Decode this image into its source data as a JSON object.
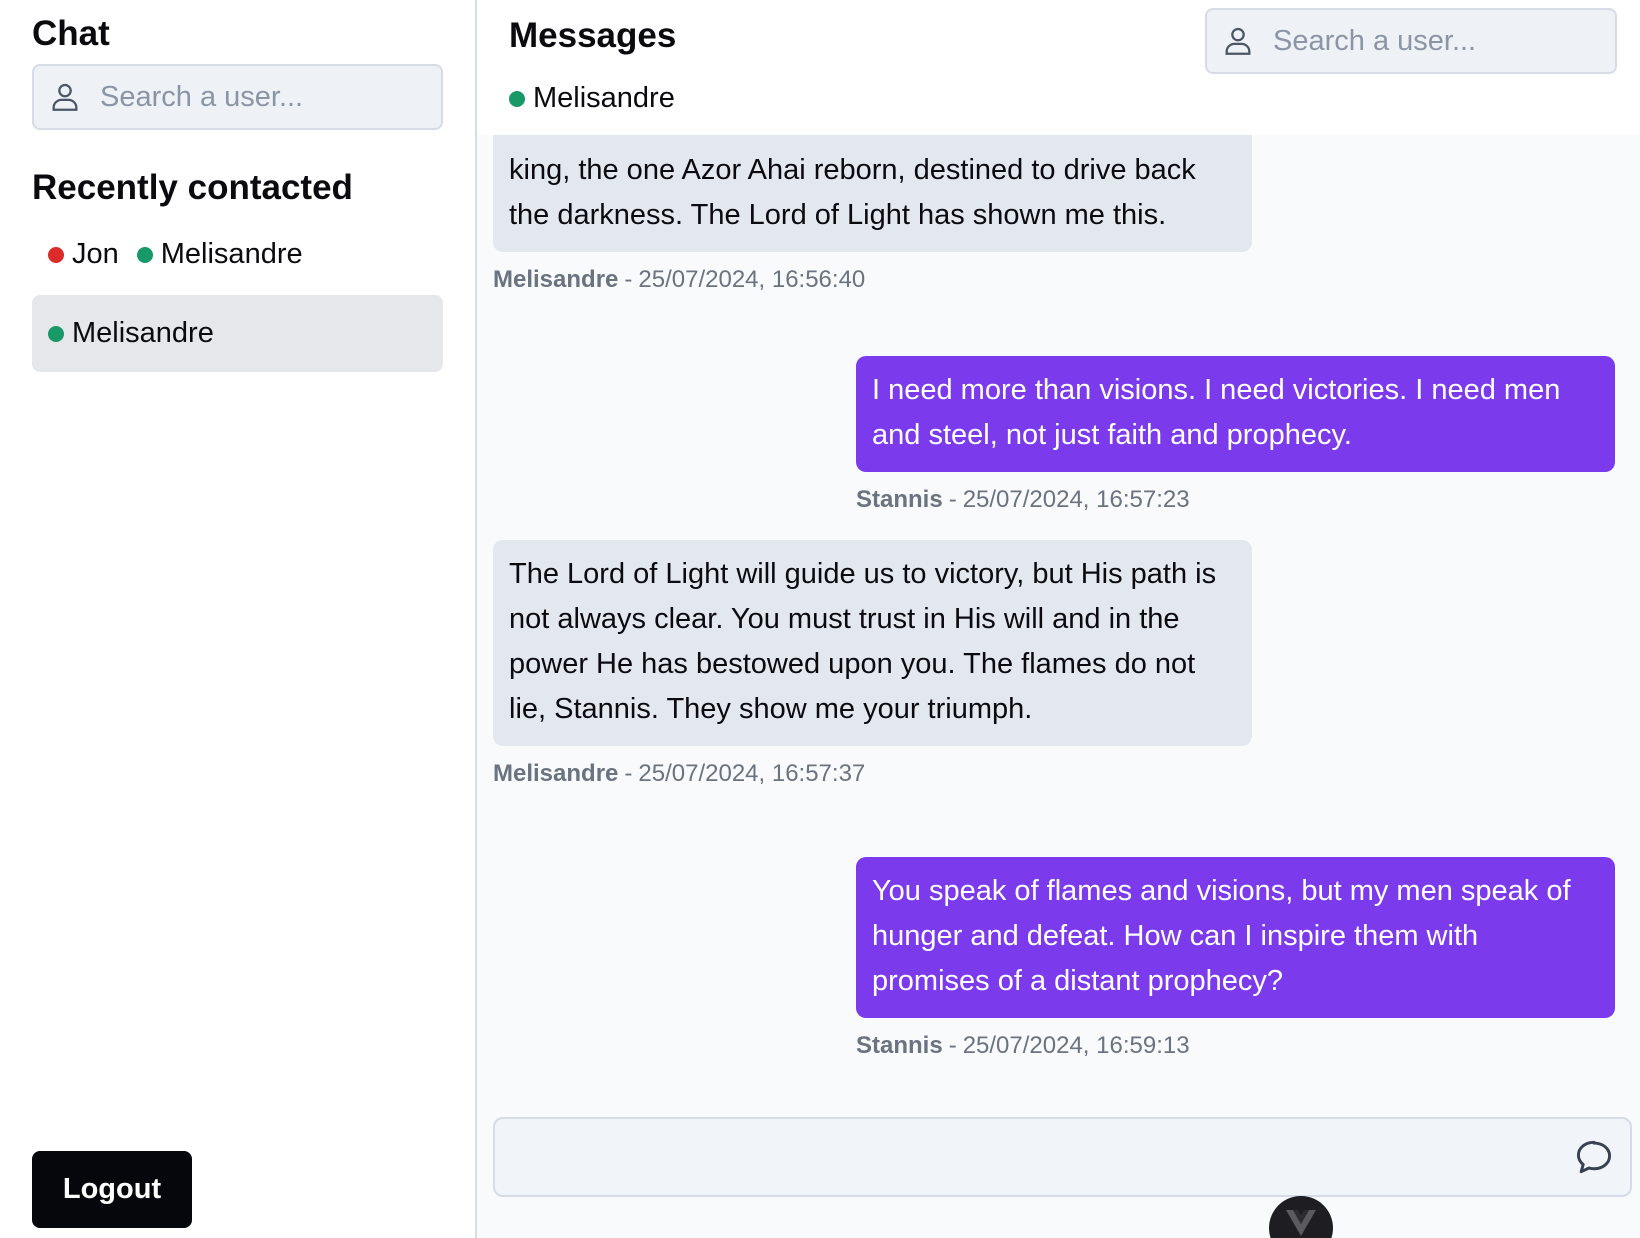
{
  "sidebar": {
    "title": "Chat",
    "search_placeholder": "Search a user...",
    "recent_title": "Recently contacted",
    "recent": [
      {
        "name": "Jon",
        "status": "offline",
        "color": "#dc2b2b"
      },
      {
        "name": "Melisandre",
        "status": "online",
        "color": "#199868"
      }
    ],
    "selected_contact": {
      "name": "Melisandre",
      "status": "online"
    },
    "logout_label": "Logout"
  },
  "main": {
    "title": "Messages",
    "active_user": "Melisandre",
    "search_placeholder": "Search a user...",
    "messages": [
      {
        "from": "them",
        "text": "king, the one Azor Ahai reborn, destined to drive back the darkness. The Lord of Light has shown me this.",
        "author": "Melisandre",
        "time": "25/07/2024, 16:56:40"
      },
      {
        "from": "me",
        "text": "I need more than visions. I need victories. I need men and steel, not just faith and prophecy.",
        "author": "Stannis",
        "time": "25/07/2024, 16:57:23"
      },
      {
        "from": "them",
        "text": "The Lord of Light will guide us to victory, but His path is not always clear. You must trust in His will and in the power He has bestowed upon you. The flames do not lie, Stannis. They show me your triumph.",
        "author": "Melisandre",
        "time": "25/07/2024, 16:57:37"
      },
      {
        "from": "me",
        "text": "You speak of flames and visions, but my men speak of hunger and defeat. How can I inspire them with promises of a distant prophecy?",
        "author": "Stannis",
        "time": "25/07/2024, 16:59:13"
      }
    ],
    "composer_value": "",
    "meta_separator": "-"
  },
  "colors": {
    "accent": "#7c3aed",
    "incoming_bubble": "#e3e8ef",
    "online": "#199868",
    "offline": "#dc2b2b",
    "logout_bg": "#05070c"
  },
  "icons": [
    "user-icon",
    "chat-bubble-icon",
    "vue-logo-icon"
  ]
}
